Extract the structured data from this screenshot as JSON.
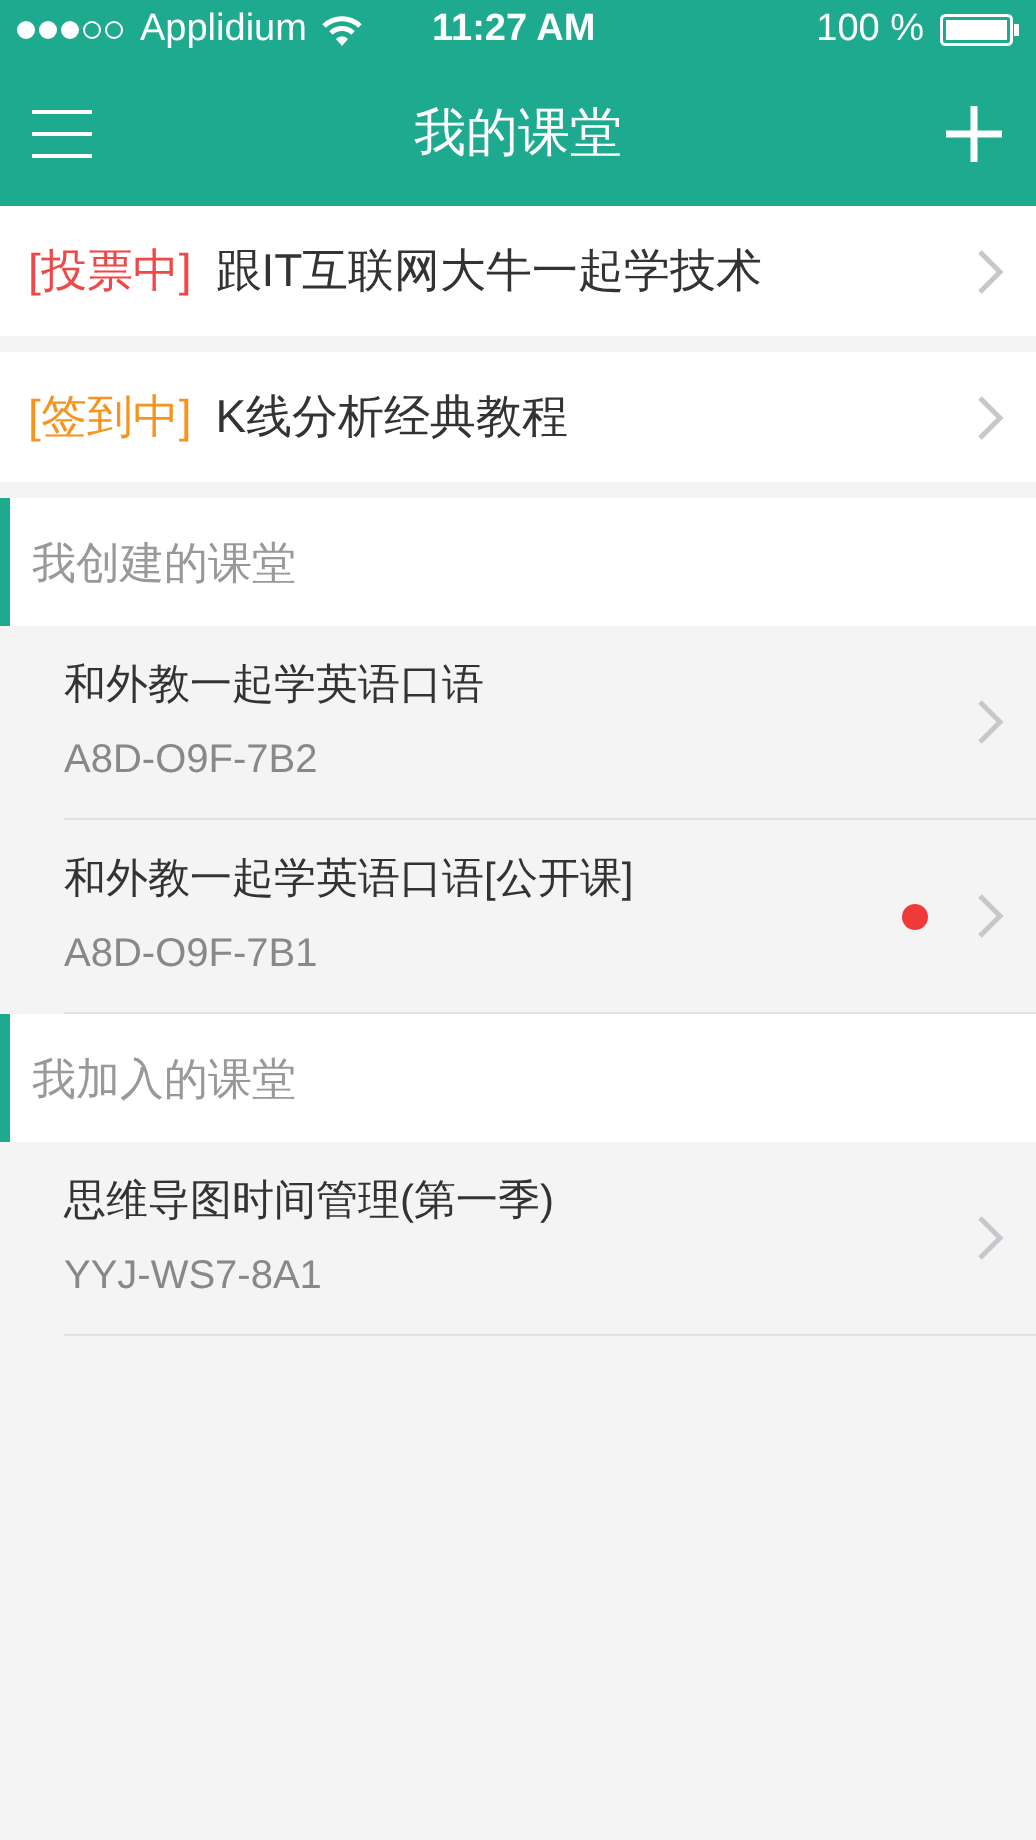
{
  "status_bar": {
    "carrier": "Applidium",
    "time": "11:27 AM",
    "battery": "100 %"
  },
  "nav_bar": {
    "title": "我的课堂"
  },
  "active_classes": [
    {
      "tag": "[投票中]",
      "color": "#f04848",
      "title": "跟IT互联网大牛一起学技术"
    },
    {
      "tag": "[签到中]",
      "color": "#f7941d",
      "title": "K线分析经典教程"
    }
  ],
  "sections": [
    {
      "title": "我创建的课堂",
      "courses": [
        {
          "name": "和外教一起学英语口语",
          "code": "A8D-O9F-7B2",
          "unread": false
        },
        {
          "name": "和外教一起学英语口语[公开课]",
          "code": "A8D-O9F-7B1",
          "unread": true
        }
      ]
    },
    {
      "title": "我加入的课堂",
      "courses": [
        {
          "name": "思维导图时间管理(第一季)",
          "code": "YYJ-WS7-8A1",
          "unread": false
        }
      ]
    }
  ]
}
